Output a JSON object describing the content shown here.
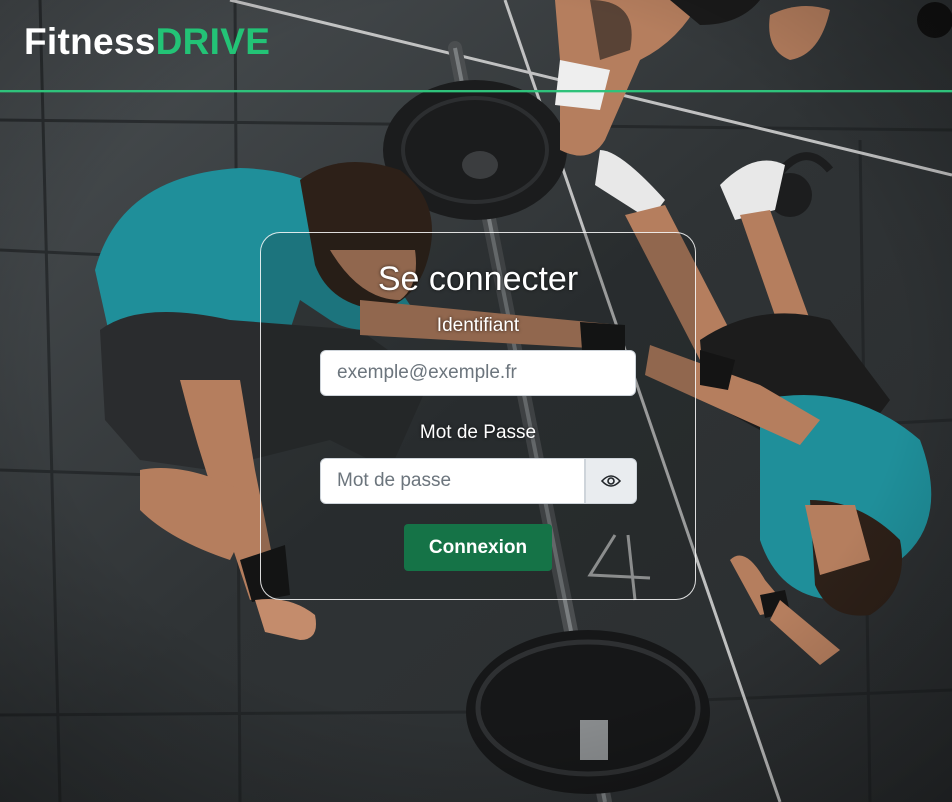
{
  "brand": {
    "name_part1": "Fitness",
    "name_part2": "DRIVE",
    "accent_color": "#23c376"
  },
  "login": {
    "title": "Se connecter",
    "identifier_label": "Identifiant",
    "identifier_placeholder": "exemple@exemple.fr",
    "identifier_value": "",
    "password_label": "Mot de Passe",
    "password_placeholder": "Mot de passe",
    "password_value": "",
    "show_password_icon": "eye-icon",
    "submit_label": "Connexion",
    "submit_color": "#157347"
  },
  "background": {
    "description_icon": "gym-photo",
    "barbell_chalk_mark": "4"
  }
}
